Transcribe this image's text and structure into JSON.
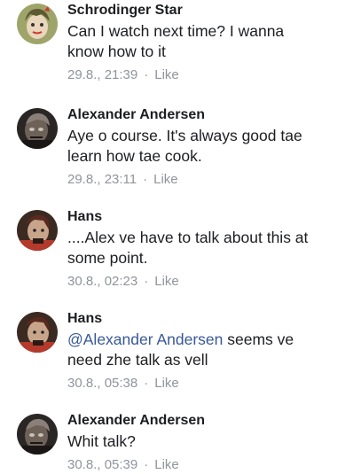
{
  "comments": [
    {
      "author": "Schrodinger Star",
      "lines": [
        "Can I watch next time? I wanna",
        "know how to it"
      ],
      "timestamp": "29.8., 21:39",
      "separator": "·",
      "like_label": "Like",
      "avatar_colors": {
        "bg": "#9fa56a",
        "face": "#e9d6bd",
        "hair": "#5b5a33",
        "accent": "#c43b2f"
      }
    },
    {
      "author": "Alexander Andersen",
      "lines": [
        "Aye o course. It's always good tae",
        "learn how tae cook."
      ],
      "timestamp": "29.8., 23:11",
      "separator": "·",
      "like_label": "Like",
      "avatar_colors": {
        "bg": "#2a2626",
        "face": "#6e6258",
        "hair": "#8a8079",
        "accent": "#c9c2b8"
      }
    },
    {
      "author": "Hans",
      "lines": [
        "....Alex ve have to talk about this at",
        "some point."
      ],
      "timestamp": "30.8., 02:23",
      "separator": "·",
      "like_label": "Like",
      "avatar_colors": {
        "bg": "#3a2a22",
        "face": "#c8a58a",
        "hair": "#5a2a1e",
        "accent": "#b43a2b"
      }
    },
    {
      "author": "Hans",
      "mention": "@Alexander Andersen",
      "lines": [
        " seems ve",
        "need zhe talk as vell"
      ],
      "timestamp": "30.8., 05:38",
      "separator": "·",
      "like_label": "Like",
      "avatar_colors": {
        "bg": "#3a2a22",
        "face": "#c8a58a",
        "hair": "#5a2a1e",
        "accent": "#b43a2b"
      }
    },
    {
      "author": "Alexander Andersen",
      "lines": [
        "Whit talk?"
      ],
      "timestamp": "30.8., 05:39",
      "separator": "·",
      "like_label": "Like",
      "avatar_colors": {
        "bg": "#2a2626",
        "face": "#6e6258",
        "hair": "#8a8079",
        "accent": "#c9c2b8"
      }
    }
  ]
}
